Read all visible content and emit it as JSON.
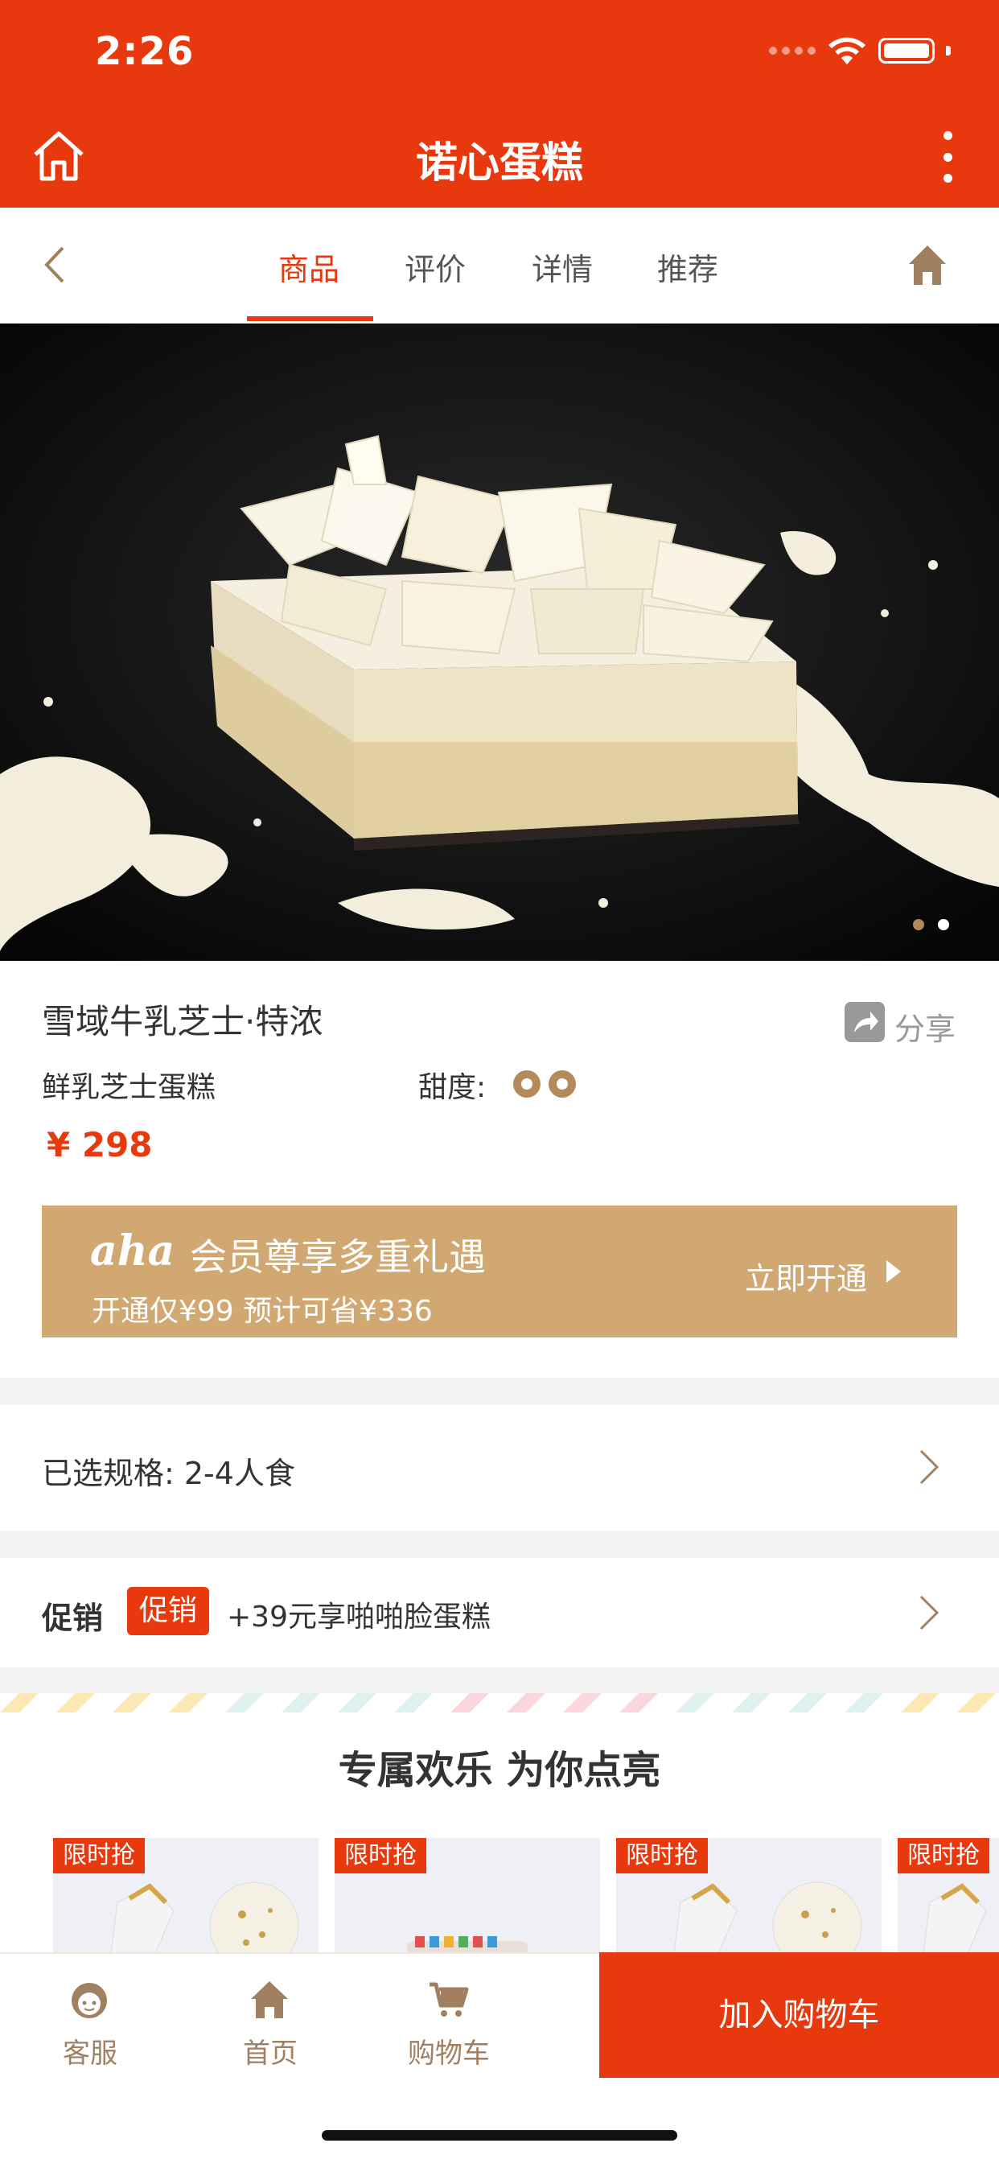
{
  "status": {
    "time": "2:26"
  },
  "header": {
    "title": "诺心蛋糕"
  },
  "tabs": [
    {
      "label": "商品",
      "active": true
    },
    {
      "label": "评价"
    },
    {
      "label": "详情"
    },
    {
      "label": "推荐"
    }
  ],
  "gallery": {
    "slide_count": 2,
    "current_slide": 1
  },
  "product": {
    "name": "雪域牛乳芝士·特浓",
    "share_label": "分享",
    "subtitle": "鲜乳芝士蛋糕",
    "sweetness_label": "甜度:",
    "sweetness_level": 2,
    "price": "¥ 298"
  },
  "membership": {
    "logo_text": "aha",
    "title": "会员尊享多重礼遇",
    "subtitle": "开通仅¥99 预计可省¥336",
    "cta": "立即开通"
  },
  "spec": {
    "text": "已选规格: 2-4人食"
  },
  "promotion": {
    "label": "促销",
    "badge": "促销",
    "text": "+39元享啪啪脸蛋糕"
  },
  "recommend": {
    "title": "专属欢乐 为你点亮",
    "badges": [
      "限时抢",
      "限时抢",
      "限时抢",
      "限时抢"
    ]
  },
  "bottom_nav": {
    "service": "客服",
    "home": "首页",
    "cart": "购物车",
    "add_to_cart": "加入购物车"
  },
  "colors": {
    "brand": "#e8390e",
    "gold": "#d1a872",
    "icon_brown": "#a08060"
  }
}
